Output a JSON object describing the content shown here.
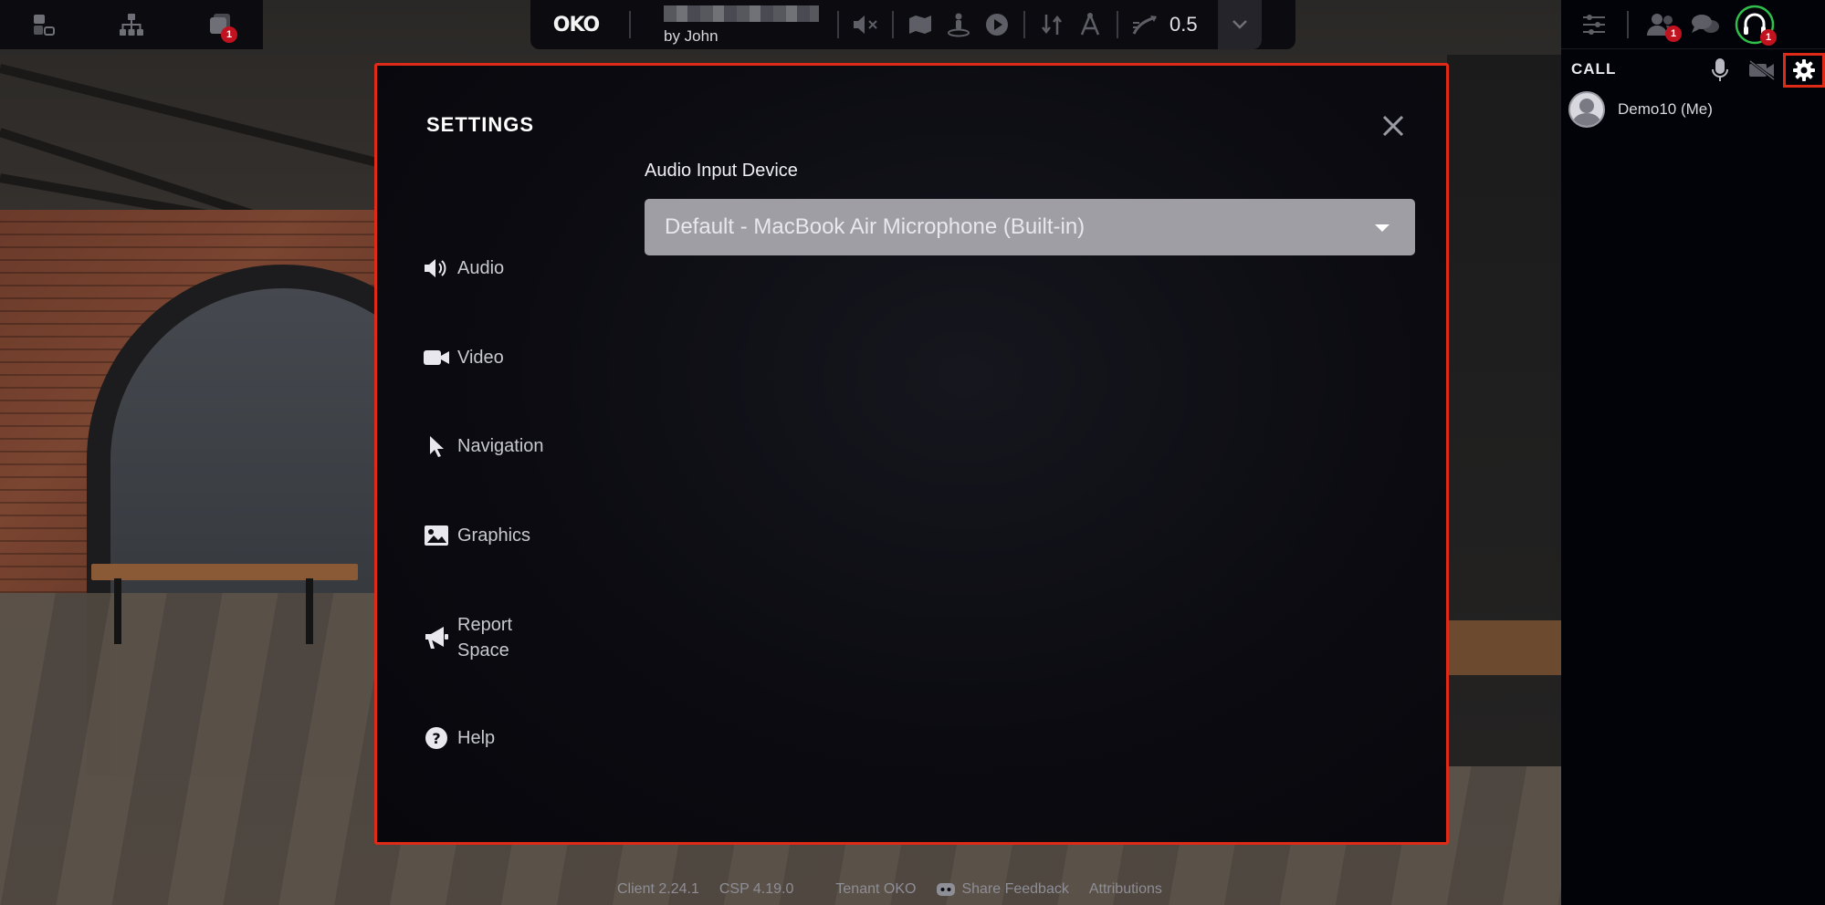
{
  "toolbar_left": {
    "items": [
      {
        "icon": "layers-icon"
      },
      {
        "icon": "hierarchy-icon"
      },
      {
        "icon": "objects-icon",
        "badge": "1"
      }
    ]
  },
  "toolbar_center": {
    "logo": "OKO",
    "space_byline": "by John",
    "zoom_value": "0.5",
    "icons": [
      "mute-icon",
      "map-icon",
      "teleport-icon",
      "play-icon",
      "sort-icon",
      "measure-icon",
      "fly-speed-icon"
    ]
  },
  "call_panel": {
    "top_icons": [
      "filters-icon",
      "participants-icon",
      "chat-icon",
      "headset-icon"
    ],
    "participants_badge": "1",
    "headset_badge": "1",
    "title": "CALL",
    "participants": [
      {
        "name": "Demo10 (Me)"
      }
    ]
  },
  "settings": {
    "title": "SETTINGS",
    "nav": [
      {
        "label": "Audio",
        "icon": "speaker-icon"
      },
      {
        "label": "Video",
        "icon": "camera-icon"
      },
      {
        "label": "Navigation",
        "icon": "cursor-icon"
      },
      {
        "label": "Graphics",
        "icon": "image-icon"
      },
      {
        "label_line1": "Report",
        "label_line2": "Space",
        "icon": "megaphone-icon"
      },
      {
        "label": "Help",
        "icon": "help-icon"
      }
    ],
    "audio_input_label": "Audio Input Device",
    "audio_input_value": "Default - MacBook Air Microphone (Built-in)"
  },
  "footer": {
    "client": "Client 2.24.1",
    "csp": "CSP 4.19.0",
    "tenant": "Tenant OKO",
    "share_feedback": "Share Feedback",
    "attributions": "Attributions"
  },
  "colors": {
    "highlight": "#e02a18",
    "badge": "#c1121f",
    "headset_accent": "#2fbf4a"
  }
}
